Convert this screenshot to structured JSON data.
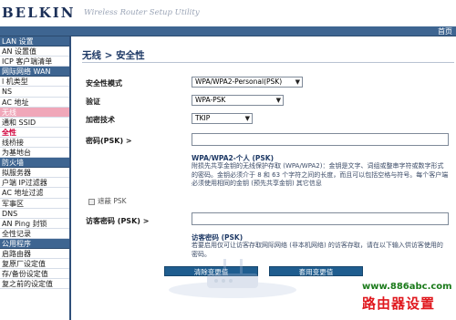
{
  "header": {
    "brand": "BELKIN",
    "tagline": "Wireless Router Setup Utility",
    "home_link": "首页"
  },
  "sidebar": {
    "items": [
      {
        "label": "LAN 设置",
        "kind": "head"
      },
      {
        "label": "AN 设置值",
        "kind": "item"
      },
      {
        "label": "ICP 客户端清单",
        "kind": "item"
      },
      {
        "label": "网际网络 WAN",
        "kind": "head"
      },
      {
        "label": "l 机类型",
        "kind": "item"
      },
      {
        "label": "NS",
        "kind": "item"
      },
      {
        "label": "AC 地址",
        "kind": "item"
      },
      {
        "label": "无线",
        "kind": "highlight-head"
      },
      {
        "label": "通和 SSID",
        "kind": "item"
      },
      {
        "label": "全性",
        "kind": "active"
      },
      {
        "label": "线桥接",
        "kind": "item"
      },
      {
        "label": "为基地台",
        "kind": "item"
      },
      {
        "label": "防火墙",
        "kind": "head"
      },
      {
        "label": "拟服务器",
        "kind": "item"
      },
      {
        "label": "户端 IP过滤器",
        "kind": "item"
      },
      {
        "label": "AC 地址过滤",
        "kind": "item"
      },
      {
        "label": "军事区",
        "kind": "item"
      },
      {
        "label": "DNS",
        "kind": "item"
      },
      {
        "label": "AN Ping 封锁",
        "kind": "item"
      },
      {
        "label": "全性记录",
        "kind": "item"
      },
      {
        "label": "公用程序",
        "kind": "head"
      },
      {
        "label": "启路由器",
        "kind": "item"
      },
      {
        "label": "复原厂设定值",
        "kind": "item"
      },
      {
        "label": "存/备份设定值",
        "kind": "item"
      },
      {
        "label": "复之前的设定值",
        "kind": "item"
      }
    ]
  },
  "main": {
    "title": "无线 > 安全性",
    "security_mode_label": "安全性模式",
    "security_mode_value": "WPA/WPA2-Personal(PSK)",
    "auth_label": "验证",
    "auth_value": "WPA-PSK",
    "encryption_label": "加密技术",
    "encryption_value": "TKIP",
    "password_label": "密码(PSK) >",
    "password_value": "",
    "help_title": "WPA/WPA2-个人 (PSK)",
    "help_text": "附损先共享金钥的无线保护存取 (WPA/WPA2)：金钥是文字、词组或整串字符或数字形式的密码。金钥必须介于 8 和 63 个字符之间的长度，而且可以包括空格与符号。每个客户端必须使用相同的金钥 (预先共享金钥) 其它信息",
    "mask_label": "遮蔽 PSK",
    "guest_label": "访客密码 (PSK) >",
    "guest_value": "",
    "guest_help_title": "访客密码 (PSK)",
    "guest_help_text": "若要启用仅可让访客存取网际网络 (非本机网络) 的访客存取，请在以下输入供访客使用的密码。",
    "clear_button": "清除变更值",
    "apply_button": "套用变更值"
  },
  "watermark": {
    "url": "www.886abc.com",
    "text": "路由器设置"
  },
  "colors": {
    "nav_blue": "#3e6591",
    "active_red": "#d0003b",
    "button_blue": "#1f5d8f",
    "watermark_green": "#1a7a1a",
    "watermark_red": "#e0181e"
  }
}
